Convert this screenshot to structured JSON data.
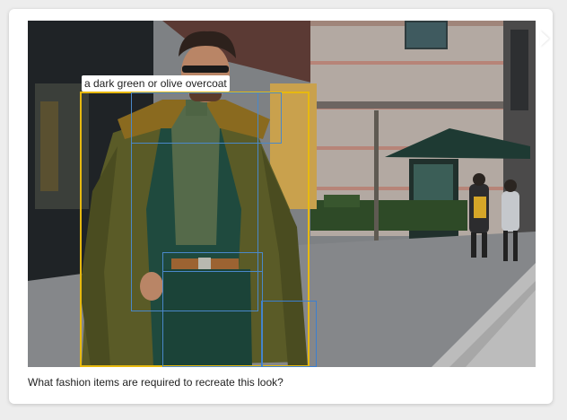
{
  "detection": {
    "label": "a dark green or olive overcoat",
    "primary_color": "#e7b90f",
    "secondary_color": "#4a88c9"
  },
  "question": "What fashion items are required to recreate this look?"
}
